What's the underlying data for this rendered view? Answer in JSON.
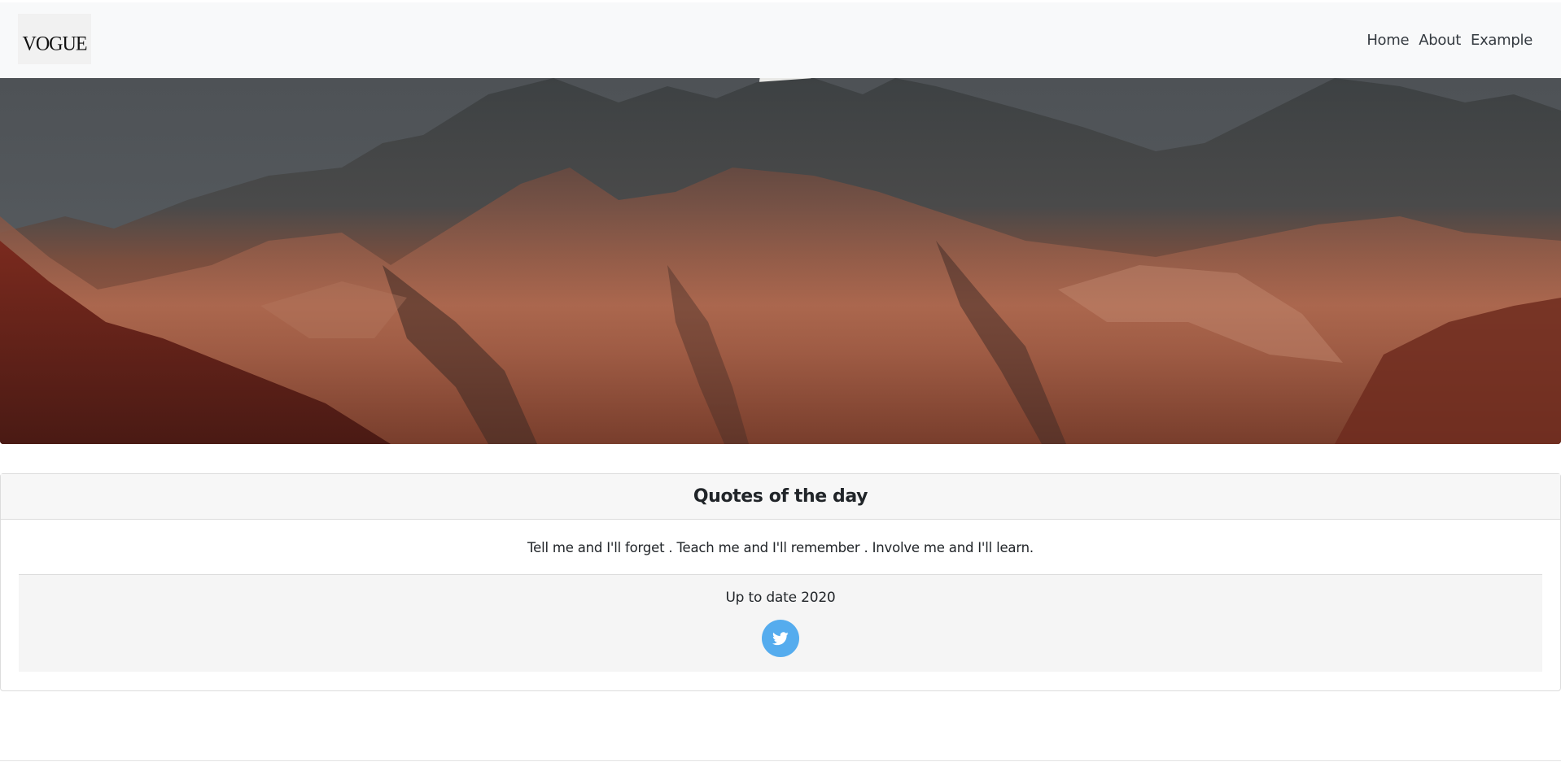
{
  "brand": {
    "logo_text": "VOGUE"
  },
  "nav": {
    "items": [
      "Home",
      "About",
      "Example"
    ]
  },
  "hero": {
    "image": "mountain-landscape"
  },
  "card": {
    "title": "Quotes of the day",
    "quote": "Tell me and I'll forget . Teach me and I'll remember . Involve me and I'll learn.",
    "footer_text": "Up to date 2020",
    "social_icon": "twitter-icon",
    "social_color": "#55acee"
  }
}
